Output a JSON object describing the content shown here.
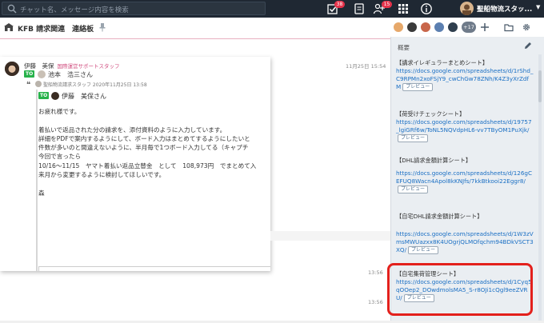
{
  "topbar": {
    "search_placeholder": "チャット名、メッセージ内容を検索",
    "tasks_badge": "38",
    "contacts_badge": "15",
    "user_name": "聖船物流スタッ..."
  },
  "room": {
    "title": "KFB 請求関連　連絡板",
    "member_overflow": "+17"
  },
  "timeline": {
    "card_time": "11月25日 15:54",
    "sender_name": "伊藤　美保",
    "sender_org": "国際運営サポートスタッフ",
    "to_tag": "TO",
    "to_name": "池本　浩三さん",
    "quote_meta": "聖船物流請求スタッフ 2020年11月25日 13:58",
    "to_tag_2": "TO",
    "to_name_2": "伊藤　美保さん",
    "body": [
      "お疲れ様です。",
      "",
      "着払いで返品された分の請求を、添付資料のように入力しています。",
      "詳細をPDFで案内するようにして、ボード入力はまとめてするようにしたいと",
      "件数が多いのと間違えないように、半月毎で1つボード入力してる（キャプチ",
      "今回で言ったら",
      "10/16～11/15　ヤマト着払い返品立替金　として　108,973円　でまとめて入",
      "来月から変更するように検討してほしいです。",
      "",
      "森"
    ],
    "time_1": "13:56",
    "time_2": "13:56"
  },
  "panel": {
    "header": "概要",
    "preview_label": "プレビュー",
    "entries": [
      {
        "title": "【講求イレギュラーまとめシート】",
        "url": "https://docs.google.com/spreadsheets/d/1rShd_C9RPMn2xoFSjY9_cwChGw78ZNh/K4Z3yXrZdfM"
      },
      {
        "title": "【荷受けチェックシート】",
        "url": "https://docs.google.com/spreadsheets/d/19757_lgiGRf6w/ToNL5NQVdpHL6-vv7TByOM1PuXjk/"
      },
      {
        "title": "【DHL請求金額計算シート】",
        "url": "https://docs.google.com/spreadsheets/d/126gCEFUQ8Wacn4Apol8kKNJfs/7kkBtkooi22Eggr8/"
      },
      {
        "title": "【自宅DHL請求金額計算シート】",
        "url": "https://docs.google.com/spreadsheets/d/1W3zVmsMWUazxx8K4UOgrjQLMOfqchm94BDkVSCT3XQ/"
      },
      {
        "title": "【自宅集荷管理シート】",
        "url": "https://docs.google.com/spreadsheets/d/1Cyq5qOOep2_DOwdmolsMA5_S-r8OJi1cQgl9eeZVRU/"
      }
    ]
  }
}
